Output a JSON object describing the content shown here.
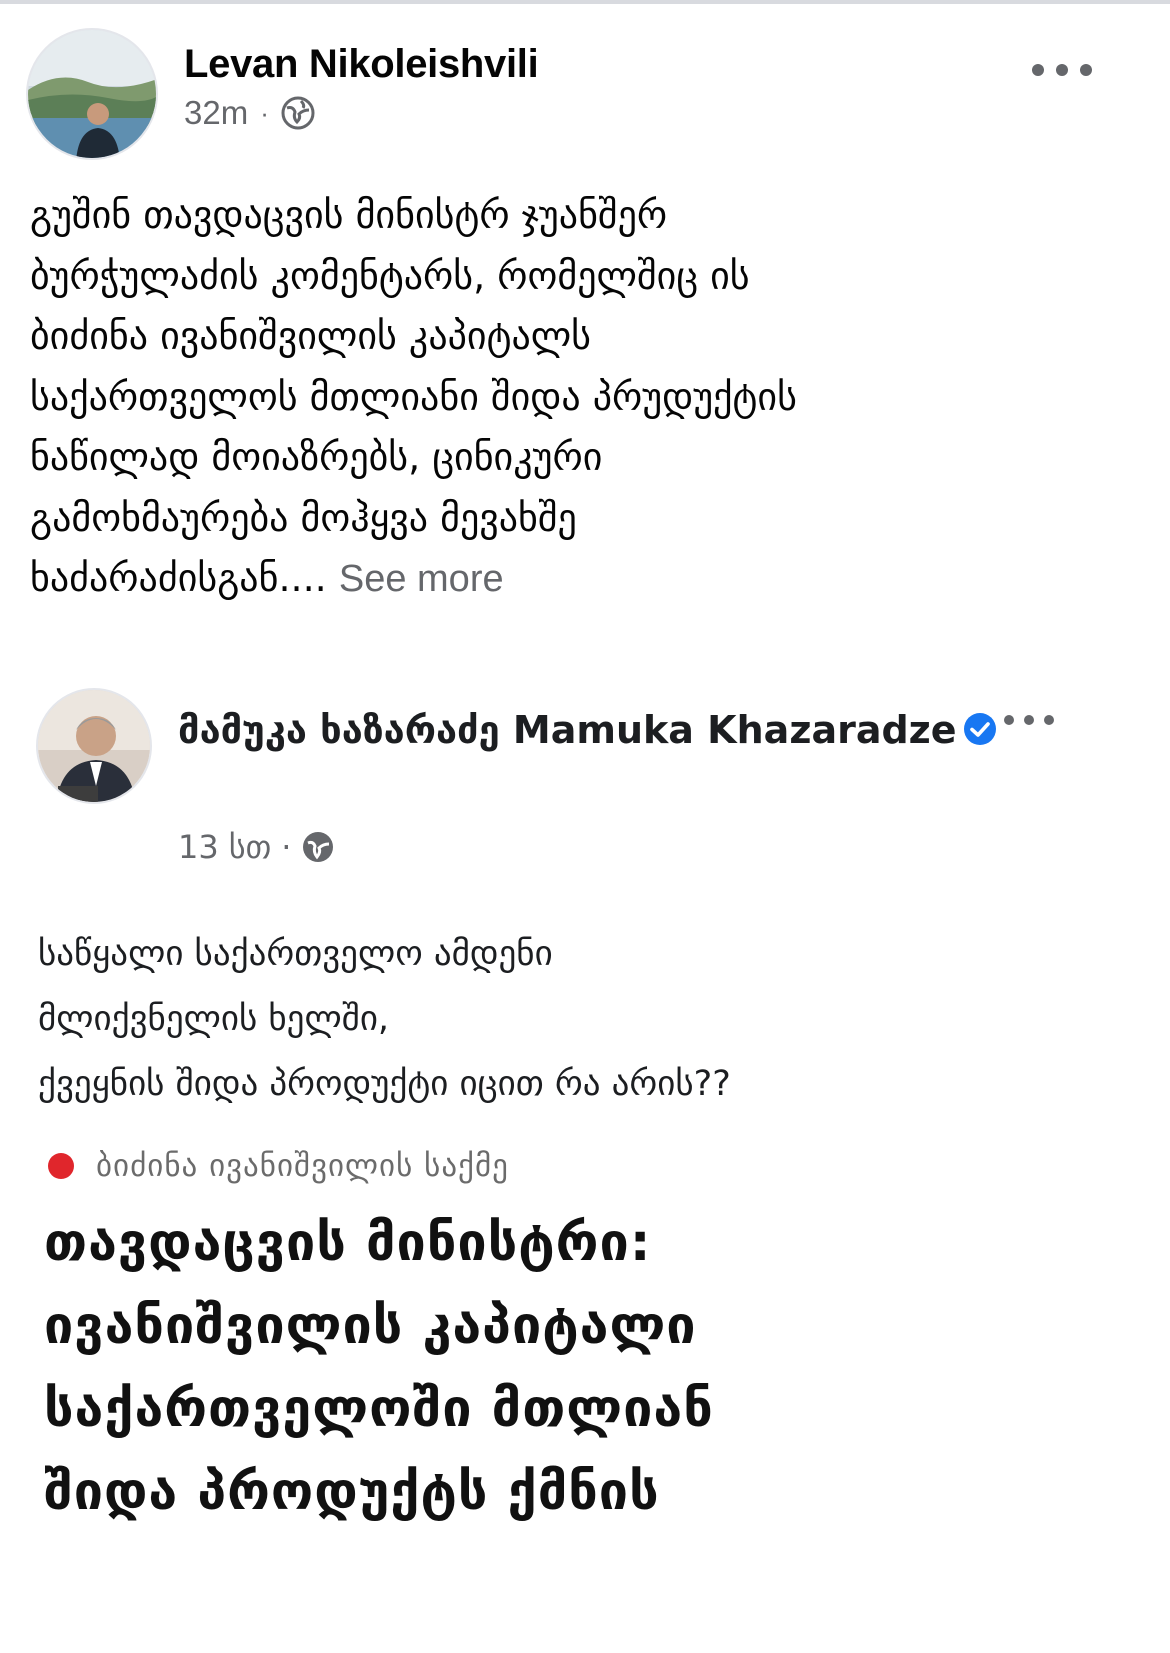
{
  "post": {
    "author": "Levan Nikoleishvili",
    "time": "32m",
    "separator": "·",
    "privacy_icon": "globe-icon",
    "more_icon": "more-horizontal-icon",
    "text": "გუშინ თავდაცვის მინისტრ ჯუანშერ\nბურჭულაძის კომენტარს, რომელშიც ის\nბიძინა ივანიშვილის კაპიტალს\nსაქართველოს მთლიანი შიდა პრუდუქტის\nნაწილად მოიაზრებს, ცინიკური\nგამოხმაურება მოჰყვა მევახშე\nხაძარაძისგან....",
    "see_more": "See more"
  },
  "shared_post": {
    "author": "მამუკა ხაზარაძე Mamuka Khazaradze",
    "verified_icon": "verified-badge-icon",
    "time": "13 სთ",
    "separator": "·",
    "privacy_icon": "globe-icon",
    "more_icon": "more-horizontal-icon",
    "text": "საწყალი საქართველო ამდენი\nმლიქვნელის ხელში,\nქვეყნის შიდა პროდუქტი იცით რა არის??",
    "source": "ბიძინა ივანიშვილის საქმე",
    "headline": "თავდაცვის მინისტრი:\nივანიშვილის კაპიტალი\nსაქართველოში მთლიან\nშიდა პროდუქტს ქმნის"
  },
  "colors": {
    "text": "#050505",
    "secondary": "#65676b",
    "verified": "#1877f2",
    "source_dot": "#e0262c"
  }
}
